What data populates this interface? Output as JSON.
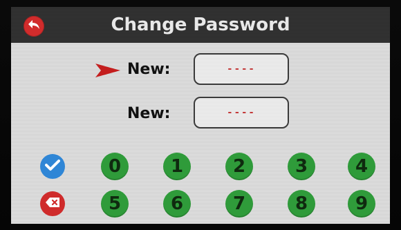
{
  "header": {
    "title": "Change Password",
    "back_icon": "back-arrow-icon"
  },
  "form": {
    "rows": [
      {
        "label": "New:",
        "value": "----",
        "active": true
      },
      {
        "label": "New:",
        "value": "----",
        "active": false
      }
    ],
    "active_indicator_icon": "red-arrow-pointer-icon"
  },
  "keypad": {
    "row1": [
      "0",
      "1",
      "2",
      "3",
      "4"
    ],
    "row2": [
      "5",
      "6",
      "7",
      "8",
      "9"
    ],
    "confirm_icon": "checkmark-icon",
    "delete_icon": "backspace-icon"
  },
  "colors": {
    "header_bg": "#2b2b2b",
    "screen_bg": "#d9d9d9",
    "digit_key": "#2f9b3a",
    "confirm": "#2f86d6",
    "delete": "#cf2b2b",
    "back": "#d12c2c",
    "indicator": "#c41e1e"
  }
}
